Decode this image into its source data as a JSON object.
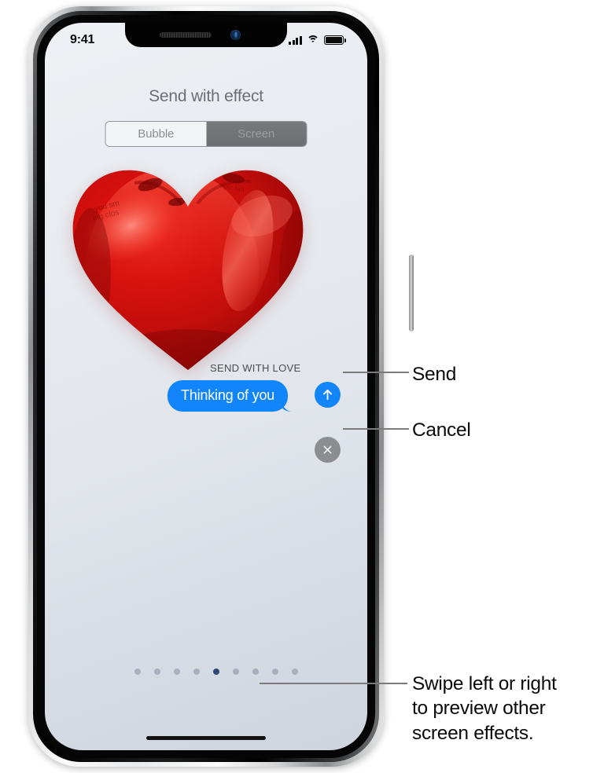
{
  "device": {
    "statusbar": {
      "time": "9:41",
      "cellular_icon": "signal-bars-icon",
      "wifi_icon": "wifi-icon",
      "battery_icon": "battery-full-icon"
    },
    "home_indicator": "home-indicator"
  },
  "sheet": {
    "title": "Send with effect",
    "segmented_control": {
      "options": [
        {
          "label": "Bubble",
          "selected": false
        },
        {
          "label": "Screen",
          "selected": true
        }
      ]
    }
  },
  "preview": {
    "effect_name": "SEND WITH LOVE",
    "effect_art": "red-heart-balloon",
    "message_text": "Thinking of you",
    "bubble_color": "#1285fb"
  },
  "actions": {
    "send": {
      "label": "Send",
      "icon": "arrow-up-icon",
      "color": "#1285fb"
    },
    "cancel": {
      "label": "Cancel",
      "icon": "close-x-icon",
      "color": "#8b8d91"
    }
  },
  "pagination": {
    "total": 9,
    "active_index": 4,
    "active_color": "#2b4a7a",
    "inactive_color": "#a9b0bd"
  },
  "callouts": {
    "send": "Send",
    "cancel": "Cancel",
    "swipe_line1": "Swipe left or right",
    "swipe_line2": "to preview other",
    "swipe_line3": "screen effects."
  }
}
